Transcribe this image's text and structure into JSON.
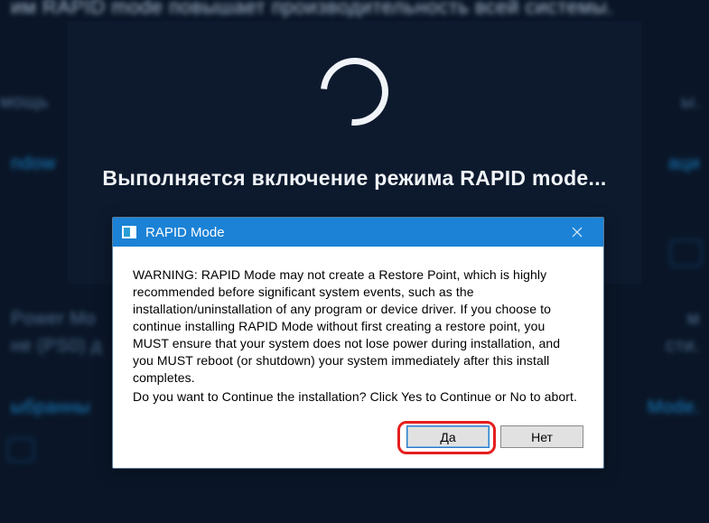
{
  "background": {
    "top_line": "им RAPID mode повышает производительность всей системы.",
    "row1_left": "мощь",
    "row1_right": "ы.",
    "row2_left": "ndow",
    "row2_right": "аци",
    "row3_left": "Power Mo\nне (PS0) д",
    "row3_right": "м\nсти.",
    "row4_left": "ыбранны",
    "row4_right": "Mode."
  },
  "loading": {
    "message": "Выполняется включение режима RAPID mode..."
  },
  "dialog": {
    "title": "RAPID Mode",
    "warning_text": "WARNING: RAPID Mode may not create a Restore Point, which is highly recommended before significant system events, such as the installation/uninstallation of any program or device driver.  If you choose to continue installing RAPID Mode without first creating a restore point, you MUST ensure that your system does not lose power during installation, and you MUST reboot (or shutdown) your system immediately after this install completes.",
    "question_text": "Do you want to Continue the installation?    Click Yes to Continue or No to abort.",
    "yes_label": "Да",
    "no_label": "Нет"
  }
}
